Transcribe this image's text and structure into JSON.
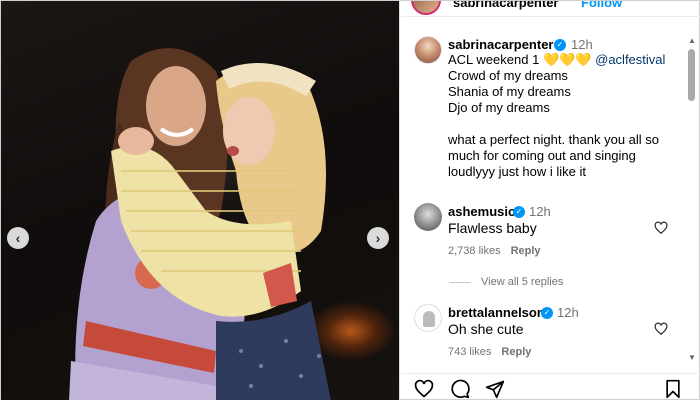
{
  "header": {
    "username": "sabrinacarpenter",
    "follow_label": "Follow"
  },
  "photo": {
    "prev_label": "‹",
    "next_label": "›"
  },
  "caption": {
    "username": "sabrinacarpenter",
    "time": "12h",
    "line1_text": "ACL weekend 1",
    "line1_emoji": "💛💛💛",
    "line1_mention": "@aclfestival",
    "line2": "Crowd of my dreams",
    "line3": "Shania of my dreams",
    "line4": "Djo of my dreams",
    "line5": "what a perfect night. thank you all so",
    "line6": "much for coming out and singing",
    "line7": "loudlyyy just how i like it"
  },
  "comments": [
    {
      "username": "ashemusic",
      "time": "12h",
      "text": "Flawless baby",
      "likes": "2,738 likes",
      "reply_label": "Reply"
    },
    {
      "username": "brettalannelson",
      "time": "12h",
      "text": "Oh she cute",
      "likes": "743 likes",
      "reply_label": "Reply"
    }
  ],
  "view_replies_label": "View all 5 replies",
  "icons": {
    "verified": "verified-badge-icon",
    "like": "heart-icon",
    "comment": "comment-icon",
    "share": "share-icon",
    "save": "bookmark-icon"
  },
  "colors": {
    "link_blue": "#0095f6",
    "mention": "#00376b",
    "muted": "#737373"
  }
}
